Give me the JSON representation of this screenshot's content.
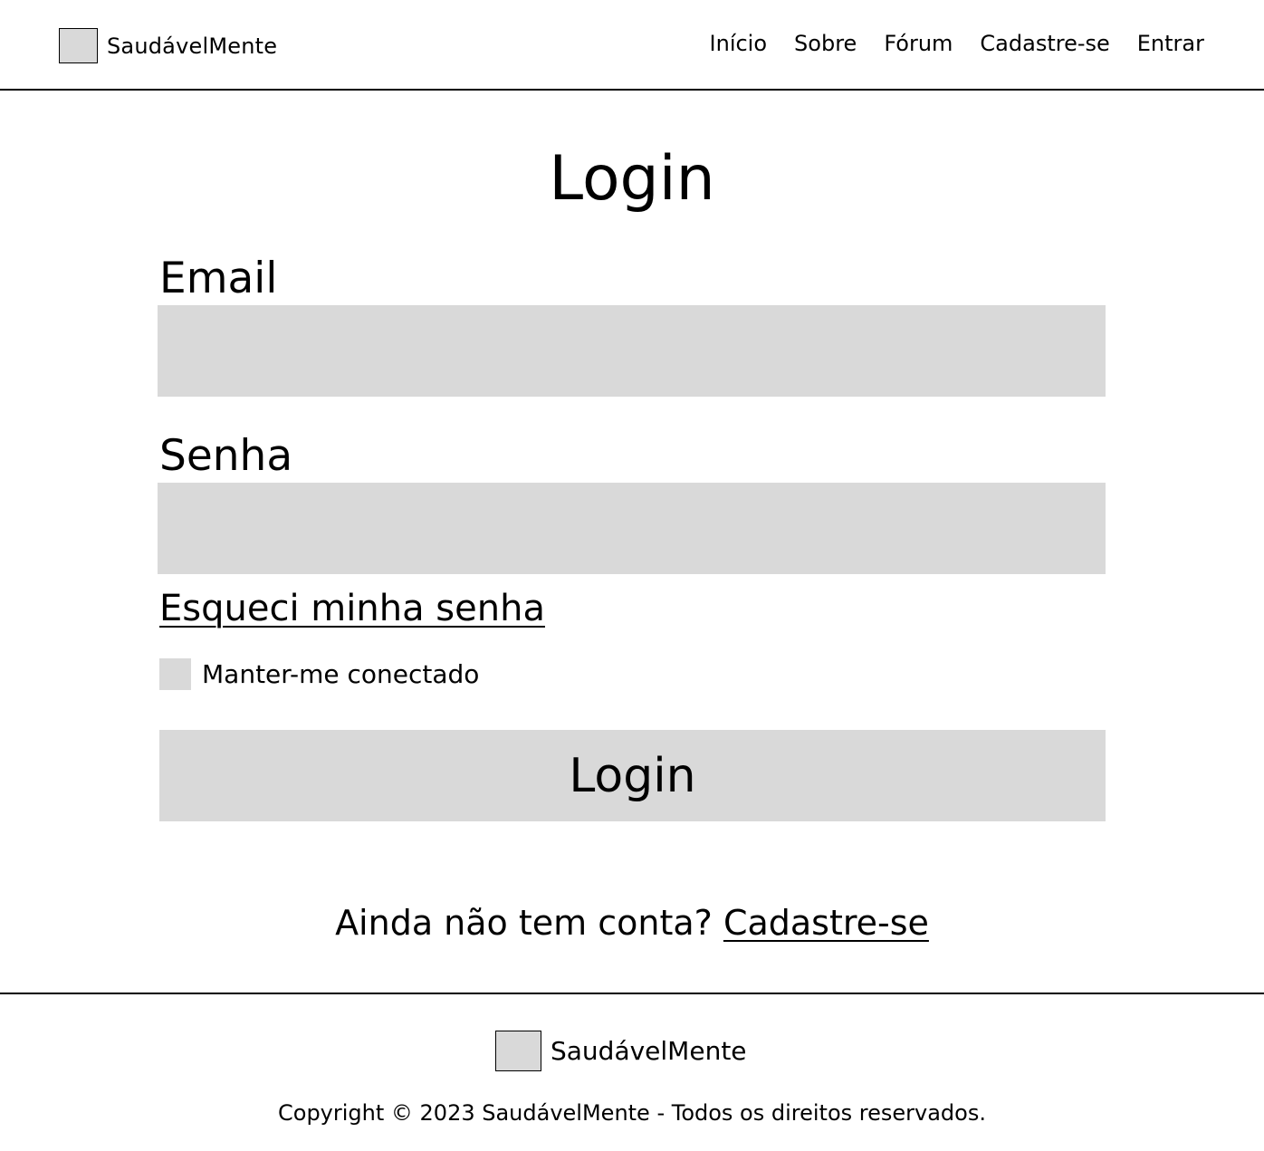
{
  "header": {
    "brand": "SaudávelMente",
    "nav": [
      "Início",
      "Sobre",
      "Fórum",
      "Cadastre-se",
      "Entrar"
    ]
  },
  "main": {
    "title": "Login",
    "email_label": "Email",
    "password_label": "Senha",
    "forgot_password": "Esqueci minha senha",
    "remember_me": "Manter-me conectado",
    "login_button": "Login",
    "signup_prompt": "Ainda não tem conta?",
    "signup_link": "Cadastre-se"
  },
  "footer": {
    "brand": "SaudávelMente",
    "copyright": "Copyright © 2023 SaudávelMente - Todos os direitos reservados."
  },
  "colors": {
    "placeholder_gray": "#d9d9d9",
    "text": "#000000",
    "background": "#ffffff"
  }
}
